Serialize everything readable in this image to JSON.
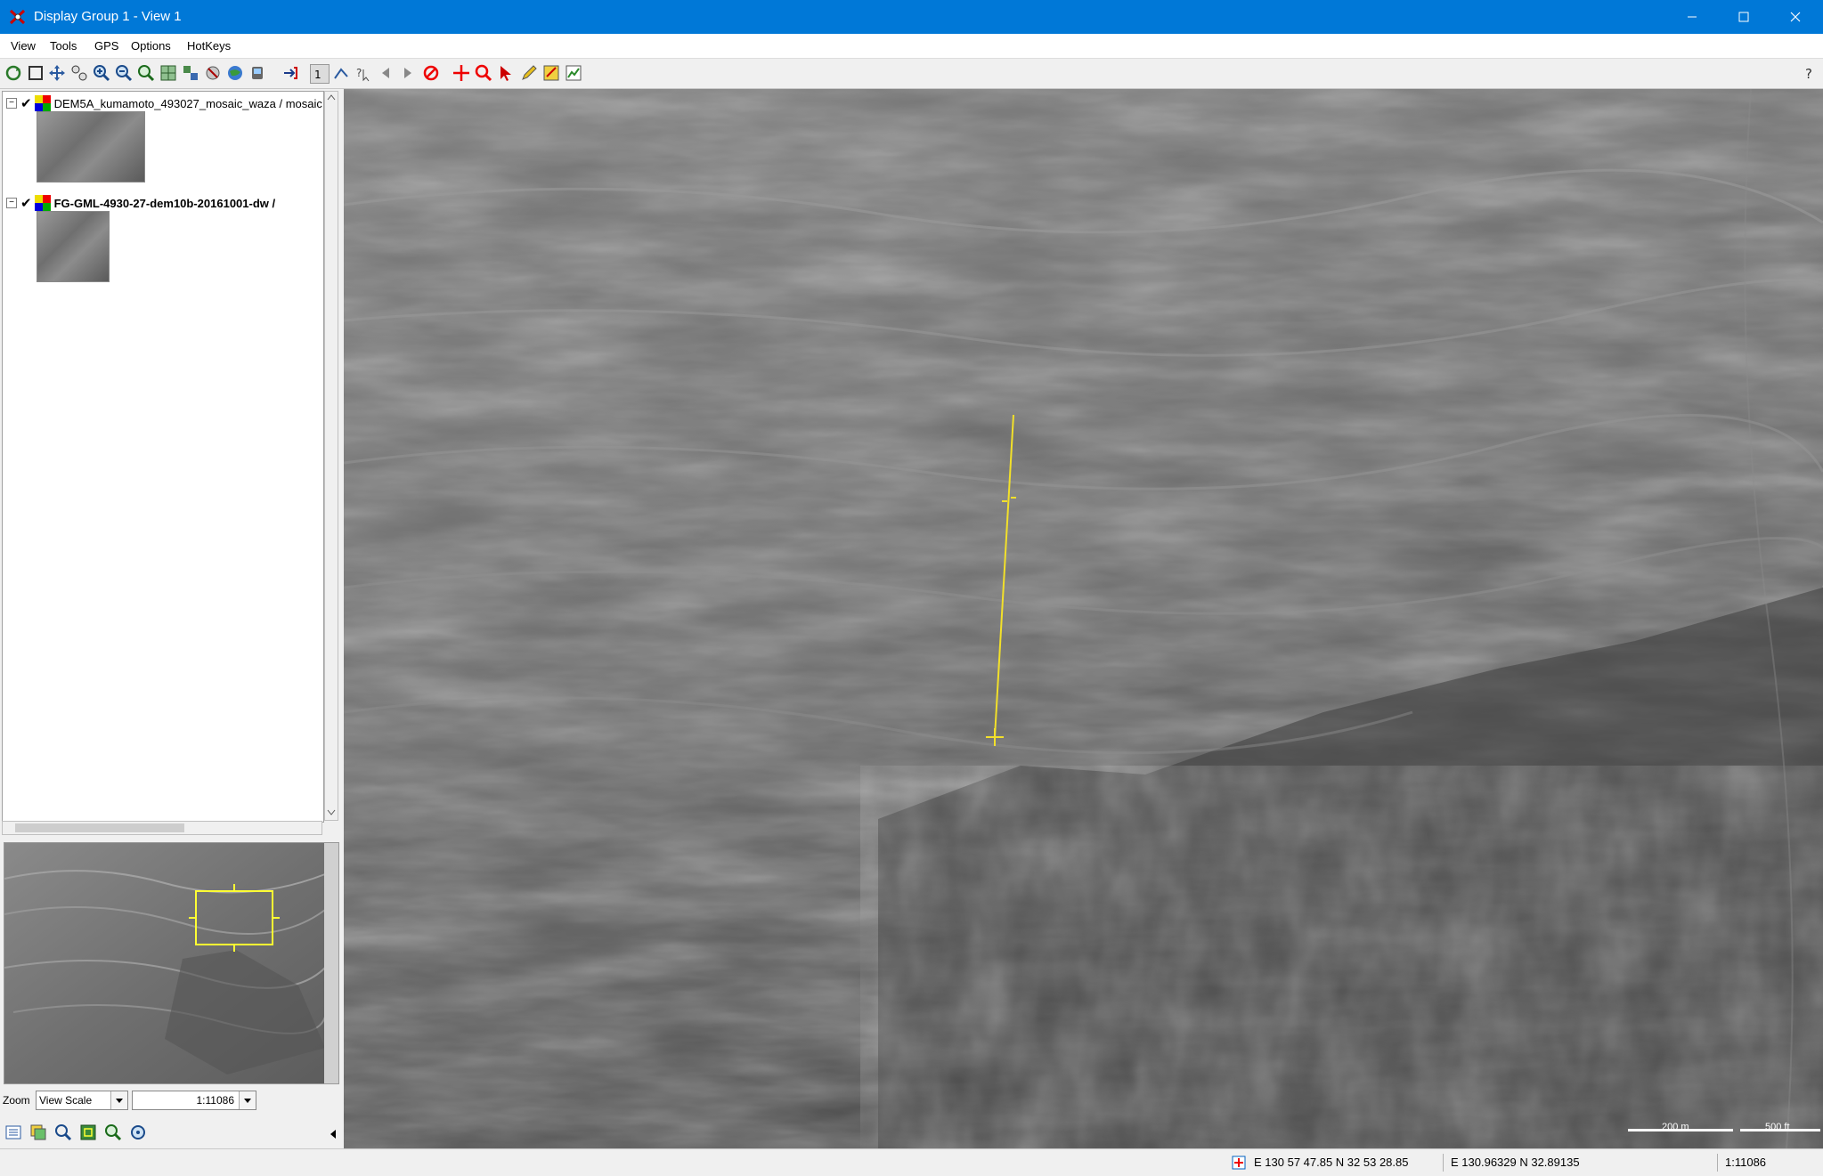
{
  "window": {
    "title": "Display Group 1 - View 1",
    "minimize_icon": "minimize-icon",
    "maximize_icon": "maximize-icon",
    "close_icon": "close-icon"
  },
  "menu": {
    "items": [
      "View",
      "Tools",
      "GPS",
      "Options",
      "HotKeys"
    ]
  },
  "toolbar": {
    "icons": [
      "redraw-icon",
      "full-extent-icon",
      "pan-icon",
      "zoom-box-icon",
      "zoom-in-icon",
      "zoom-out-icon",
      "zoom-previous-icon",
      "zoom-layer-icon",
      "zoom-selection-icon",
      "zoom-active-icon",
      "globe-icon",
      "gps-icon",
      "camera-icon",
      "add-layer-icon",
      "scale-1-1-icon",
      "measure-icon",
      "help-pointer-icon",
      "back-icon",
      "forward-icon",
      "stop-icon",
      "crosshair-icon",
      "magnifier-icon",
      "select-pointer-icon",
      "pencil-icon",
      "edit-layer-icon",
      "chart-icon"
    ],
    "help_icon": "help-icon"
  },
  "layers": [
    {
      "name": "DEM5A_kumamoto_493027_mosaic_waza / mosaic",
      "checked": true,
      "expanded": true
    },
    {
      "name": "FG-GML-4930-27-dem10b-20161001-dw /",
      "checked": true,
      "expanded": true
    }
  ],
  "zoom": {
    "label": "Zoom",
    "mode": "View Scale",
    "scale": "1:11086"
  },
  "bottom_tools": [
    "layer-list-icon",
    "layer-controls-icon",
    "find-icon",
    "overview-icon",
    "zoom-to-locator-icon",
    "locator-icon"
  ],
  "map": {
    "scalebar_metric": "200 m",
    "scalebar_imperial": "500 ft",
    "profile_line_color": "#f2e02a"
  },
  "status": {
    "gps_icon": "position-icon",
    "dms": "E 130 57 47.85  N 32 53 28.85",
    "decimal": "E 130.96329  N 32.89135",
    "scale": "1:11086"
  }
}
